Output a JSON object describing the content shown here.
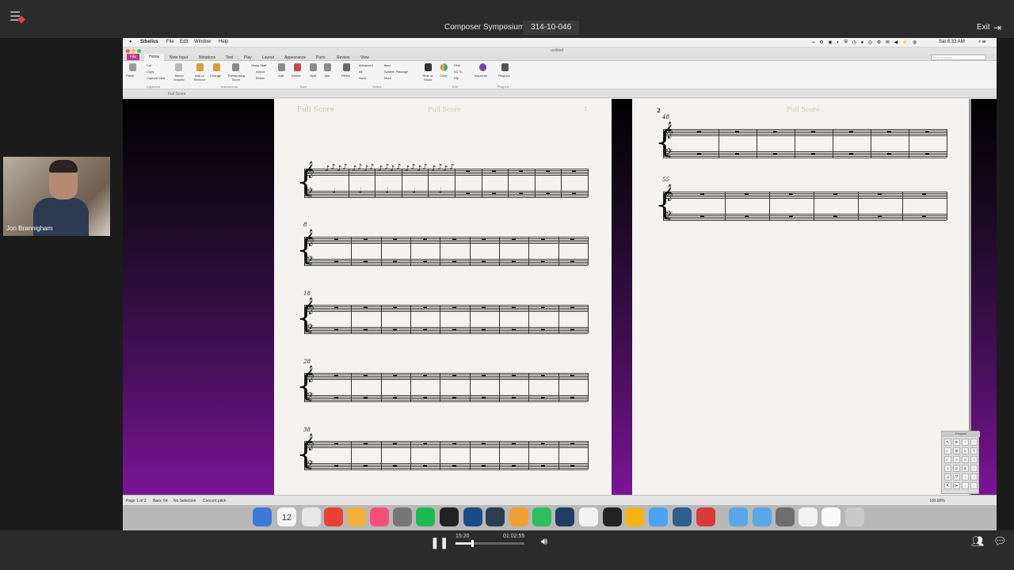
{
  "topbar": {
    "title": "Composer Symposium",
    "session_code": "314-10-046",
    "exit_label": "Exit"
  },
  "webcam": {
    "participant_name": "Jon Brannigham"
  },
  "mac_menu": {
    "app_name": "Sibelius",
    "items": [
      "File",
      "Edit",
      "Window",
      "Help"
    ],
    "clock": "Sat 8:33 AM"
  },
  "window": {
    "title": "untitled"
  },
  "ribbon_tabs": [
    "File",
    "Home",
    "Note Input",
    "Notations",
    "Text",
    "Play",
    "Layout",
    "Appearance",
    "Parts",
    "Review",
    "View"
  ],
  "search_placeholder": "Find in ribbon",
  "ribbon": {
    "paste": "Paste",
    "cut": "Cut",
    "copy": "Copy",
    "capture_idea": "Capture Idea",
    "select_graphic": "Select Graphic",
    "add_remove": "Add or Remove",
    "change": "Change",
    "transposing_score": "Transposing Score",
    "ossia_staff": "Ossia Staff",
    "above": "Above",
    "below": "Below",
    "add": "Add",
    "delete": "Delete",
    "split": "Split",
    "join": "Join",
    "filters": "Filters",
    "advanced": "Advanced",
    "all": "All",
    "none": "None",
    "bars": "Bars",
    "system_passage": "System Passage",
    "more": "More",
    "hide_show": "Hide or Show",
    "color": "Color",
    "find": "Find",
    "go_to": "Go To",
    "flip": "Flip",
    "inspector": "Inspector",
    "plugins": "Plug-ins",
    "groups": [
      "Clipboard",
      "Instruments",
      "Bars",
      "Select",
      "Edit",
      "Plug-ins"
    ]
  },
  "crumb": "Full Score",
  "score": {
    "page1": {
      "header_left": "Full Score",
      "header_center": "Full Score",
      "page_number": "1",
      "system_numbers": [
        "8",
        "18",
        "28",
        "38"
      ]
    },
    "page2": {
      "page_number": "2",
      "header_center": "Full Score",
      "system_numbers": [
        "48",
        "55"
      ]
    }
  },
  "statusbar": {
    "page": "Page 1 of 2",
    "bars": "Bars: 64",
    "selection": "No Selection",
    "pitch": "Concert pitch",
    "zoom": "100.00%"
  },
  "keypad": {
    "title": "Keypad"
  },
  "playback": {
    "current_time": "15:20",
    "total_time": "01:02:55",
    "progress": 0.244
  },
  "dock_icons": [
    "finder-icon",
    "calendar-icon",
    "clock-icon",
    "chrome-icon",
    "photos-icon",
    "itunes-icon",
    "system-preferences-icon",
    "spotify-icon",
    "sibelius-icon",
    "dp-icon",
    "vepro-icon",
    "logic-icon",
    "evernote-icon",
    "word-icon",
    "sketch-icon",
    "piano-icon",
    "butterfly-icon",
    "messages-icon",
    "scrivener-icon",
    "zoom-app-icon",
    "applications-folder-icon",
    "documents-folder-icon",
    "downloads-folder-icon",
    "drive-icon",
    "preview-icon",
    "trash-icon"
  ],
  "dock_date": "12"
}
